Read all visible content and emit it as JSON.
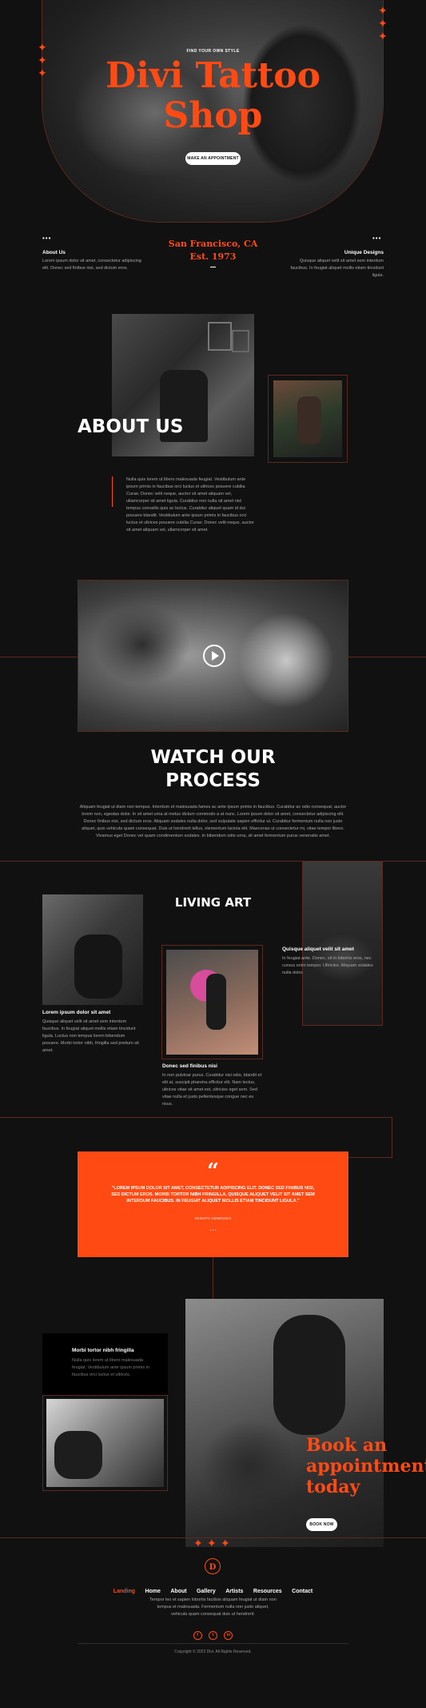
{
  "hero": {
    "eyebrow": "FIND YOUR OWN STYLE",
    "title_line1": "Divi Tattoo",
    "title_line2": "Shop",
    "cta": "MAKE AN APPOINTMENT"
  },
  "info": {
    "about_title": "About Us",
    "about_text": "Lorem ipsum dolor sit amet, consectetur adipiscing elit. Donec sed finibus nisi, sed dictum eros.",
    "city": "San Francisco, CA",
    "est": "Est. 1973",
    "designs_title": "Unique Designs",
    "designs_text": "Quisque aliquet velit sit amet sem interdum faucibus. In feugiat aliquet mollis etiam tincidunt ligula."
  },
  "about": {
    "heading": "ABOUT US",
    "text": "Nulla quis lorem ut libero malesuada feugiat. Vestibulum ante ipsum primis in faucibus orci luctus et ultrices posuere cubilia Curae; Donec velit neque, auctor sit amet aliquam vel, ullamcorper sit amet ligula. Curabitur non nulla sit amet nisl tempus convallis quis ac lectus. Curabitur aliquet quam id dui posuere blandit. Vestibulum ante ipsum primis in faucibus orci luctus et ultrices posuere cubilia Curae; Donec velit neque, auctor sit amet aliquam vel, ullamcorper sit amet."
  },
  "process": {
    "heading_line1": "WATCH OUR",
    "heading_line2": "PROCESS",
    "text": "Aliquam feugiat ut diam non tempus. Interdum et malesuada fames ac ante ipsum primis in faucibus. Curabitur ac odio consequat, auctor lorem non, egestas dolor. In sit amet urna at metus dictum commodo a at nunc. Lorem ipsum dolor sit amet, consectetur adipiscing elit. Donec finibus nisi, sed dictum eros. Aliquam sodales nulla dolor, sed vulputate sapien efficitur ut. Curabitur fermentum nulla non justo aliquet, quis vehicula quam consequat. Duis ut hendrerit tellus, elementum lacinia elit. Maecenas ut consectetur mi, vitae tempor libero. Vivamus eget Donec vel quam condimentum sodales. In bibendum odio urna, sit amet fermentum purus venenatis amet."
  },
  "living": {
    "heading": "LIVING ART",
    "card1_title": "Lorem ipsum dolor sit amet",
    "card1_text": "Quisque aliquet velit sit amet sem interdum faucibus. In feugiat aliquet mollis etiam tincidunt ligula. Luctus non tempus lorem bibendum posuere. Morbi tortor nibh, fringilla sed pretium sit amet.",
    "card2_title": "Donec sed finibus nisi",
    "card2_text": "In non pulvinar purus. Curabitur nisi odio, blandit et elit at, suscipit pharetra efficitur elit. Nam lectus, ultrices vitae sit amet est, ultricies eget sem. Sed vitae nulla et justo pellentesque congue nec eu risus.",
    "card3_title": "Quisque aliquet velit sit amet",
    "card3_text": "In feugiat ante. Donec, sit in lobortis eros, nec cursus enim tempor. Ultricies. Aliquam sodales nulla dolor."
  },
  "quote": {
    "mark": "“",
    "text": "\"LOREM IPSUM DOLOR SIT AMET, CONSECTETUR ADIPISCING ELIT. DONEC SED FINIBUS NISI, SED DICTUM EROS. MORBI TORTOR NIBH FRINGILLA, QUISQUE ALIQUET VELIT SIT AMET SEM INTERDUM FAUCIBUS. IN FEUGIAT ALIQUET MOLLIS ETIAM TINCIDUNT LIGULA.\"",
    "author": "JOSEPH EDMONDS",
    "dots": "• • •"
  },
  "booking": {
    "card_title": "Morbi tortor nibh fringilla",
    "card_text": "Nulla quis lorem ut libero malesuada feugiat. Vestibulum ante ipsum primis in faucibus orci luctus et ultrices.",
    "line1": "Book an",
    "line2": "appointment",
    "line3": "today",
    "cta": "BOOK NOW"
  },
  "footer": {
    "logo": "D",
    "nav": [
      "Landing",
      "Home",
      "About",
      "Gallery",
      "Artists",
      "Resources",
      "Contact"
    ],
    "text": "Tempor leo et sapien lobortis facilisis aliquam feugiat ut diam non tempus et malesuada. Fermentum nulla non justo aliquet, vehicula quam consequat duis ut hendrerit.",
    "copyright": "Copyright © 2022 Divi. All Rights Reserved.",
    "social": [
      "f",
      "t",
      "in"
    ]
  },
  "colors": {
    "accent": "#ff4a14",
    "background": "#111111",
    "line": "#5a2a20"
  }
}
